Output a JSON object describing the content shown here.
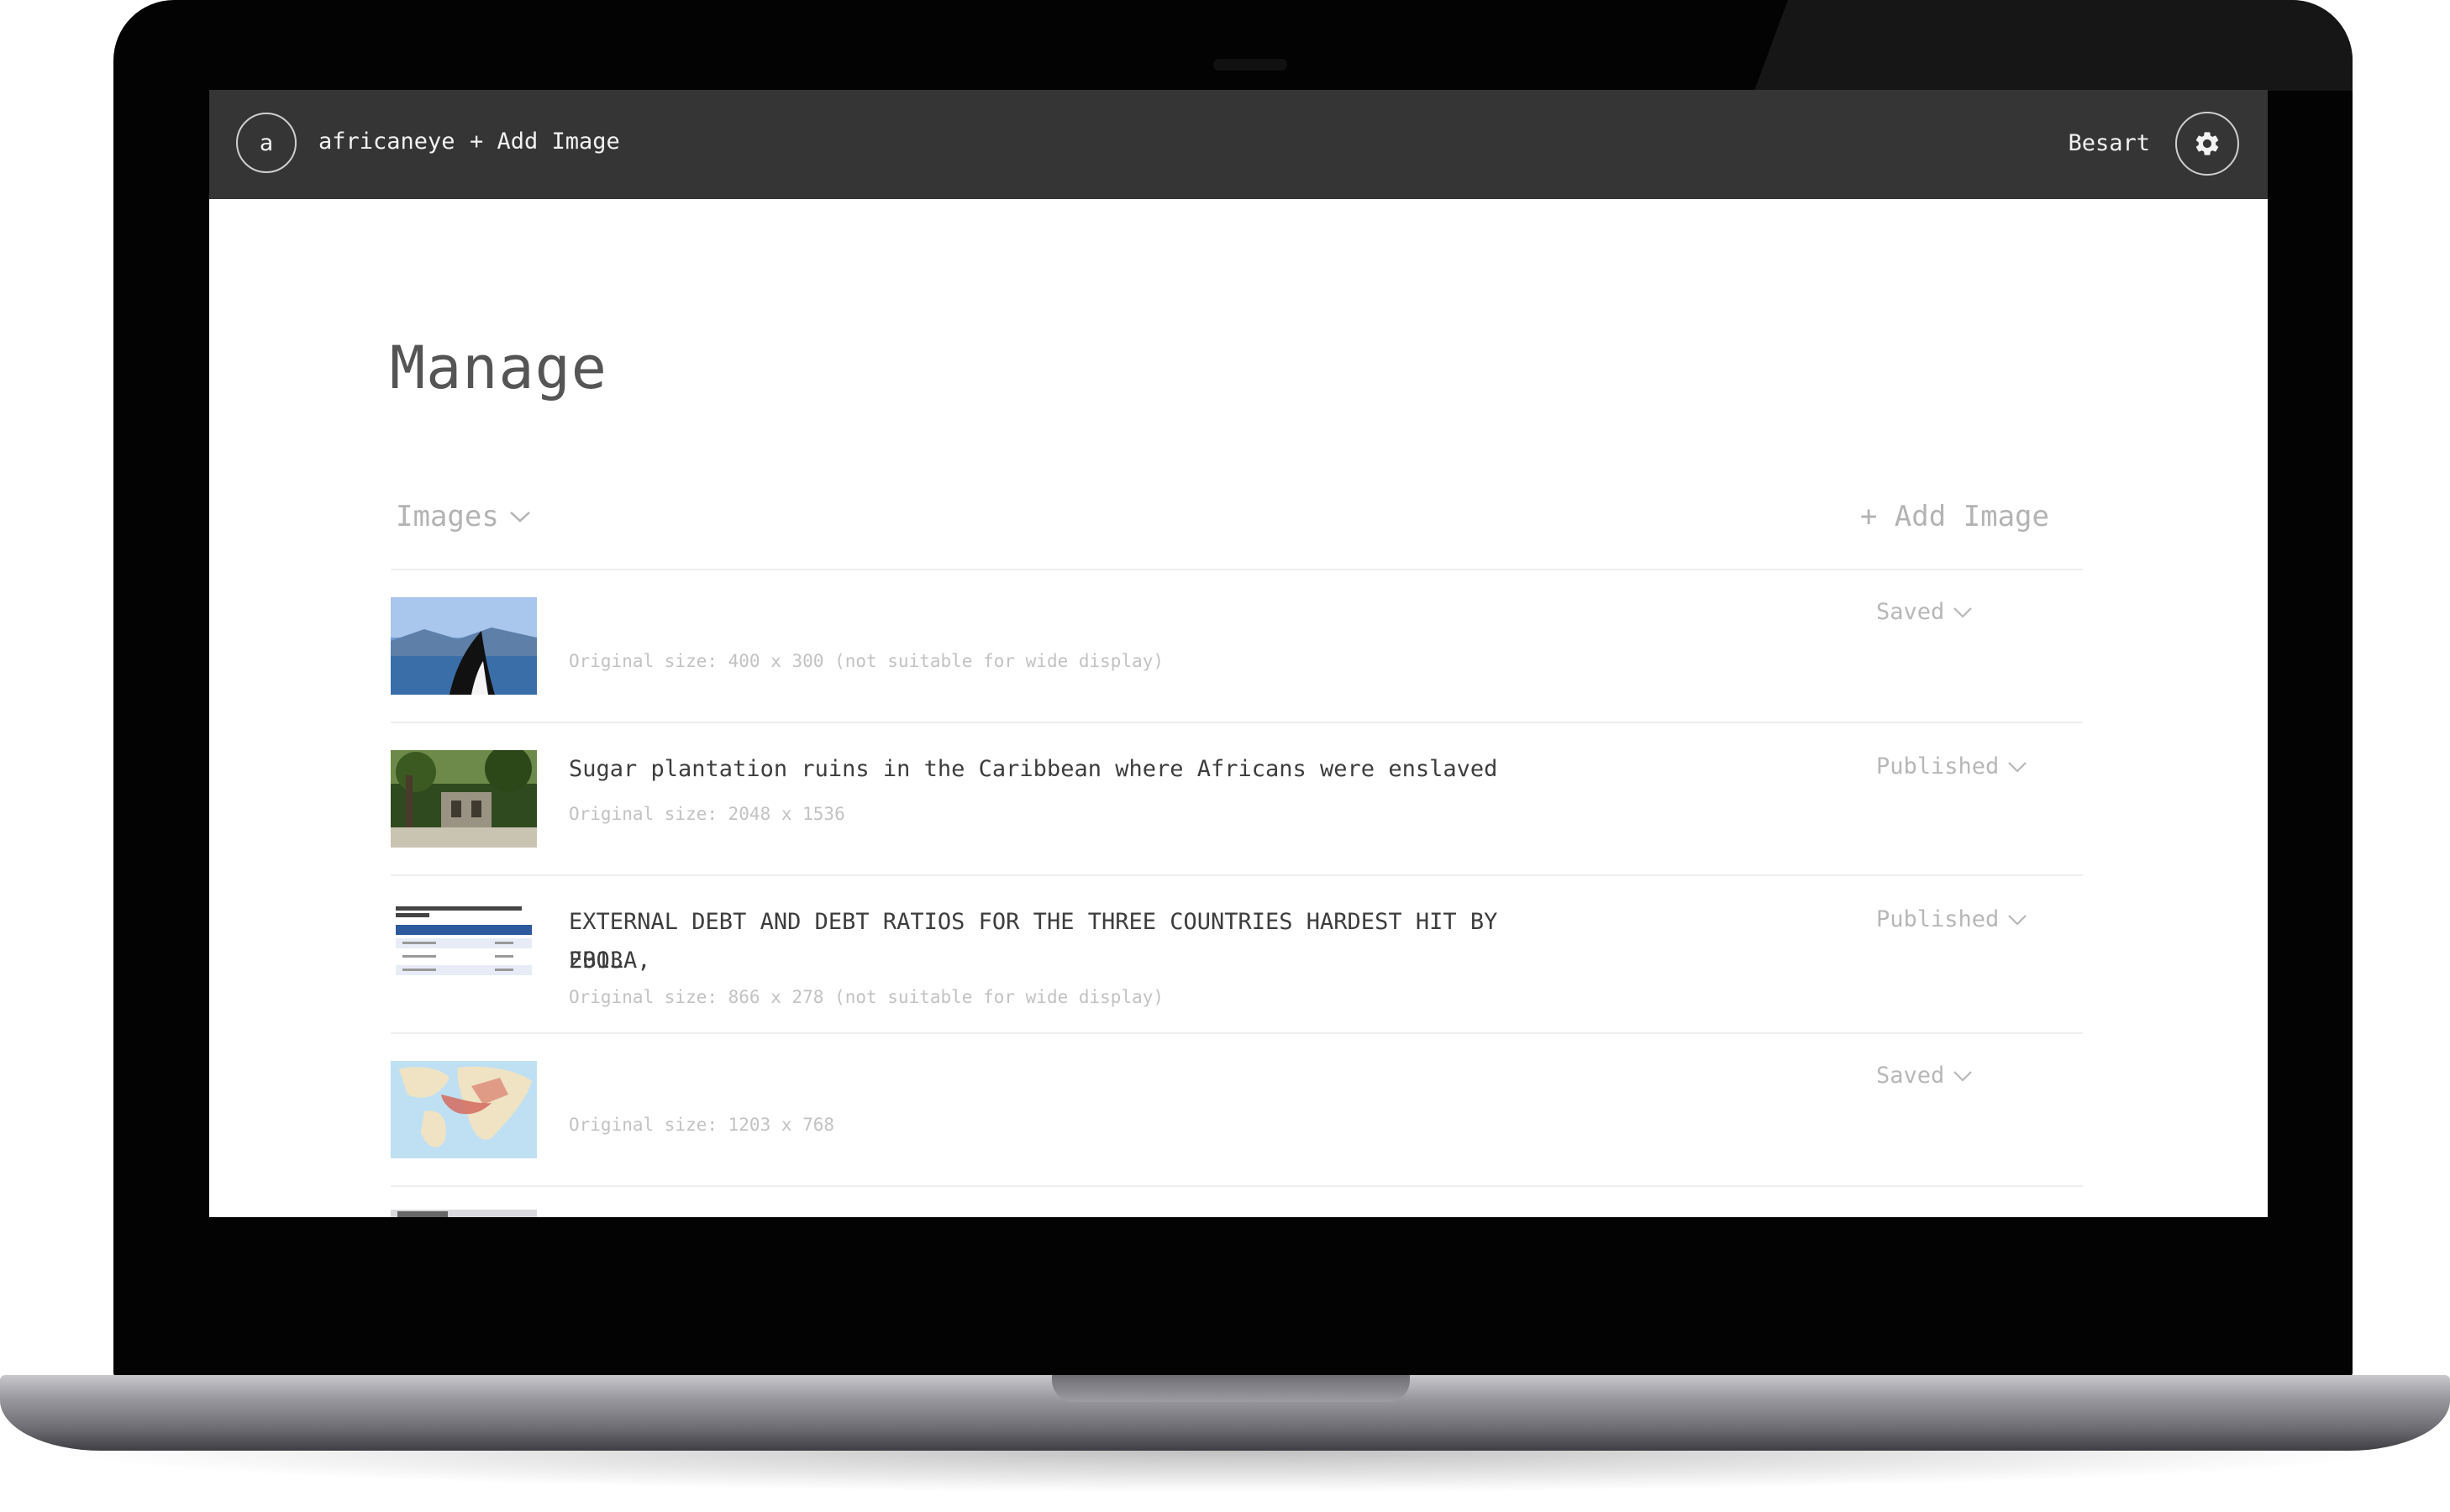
{
  "topbar": {
    "avatar_letter": "a",
    "site_name": "africaneye",
    "add_image_label": "+ Add Image",
    "user_name": "Besart"
  },
  "page": {
    "title": "Manage"
  },
  "list_header": {
    "section_label": "Images",
    "add_image_label": "+ Add Image"
  },
  "items": [
    {
      "title": "",
      "meta": "Original size: 400 x 300 (not suitable for wide display)",
      "status": "Saved",
      "thumb_desc": "orca-whale-image"
    },
    {
      "title": "Sugar plantation ruins in the Caribbean where Africans were enslaved",
      "meta": "Original size: 2048 x 1536",
      "status": "Published",
      "thumb_desc": "plantation-ruins-image"
    },
    {
      "title_line1": "EXTERNAL DEBT AND DEBT RATIOS FOR THE THREE COUNTRIES HARDEST HIT BY EBOLA,",
      "title_line2": "2013",
      "meta": "Original size: 866 x 278 (not suitable for wide display)",
      "status": "Published",
      "thumb_desc": "debt-table-image"
    },
    {
      "title": "",
      "meta": "Original size: 1203 x 768",
      "status": "Saved",
      "thumb_desc": "africa-map-image"
    }
  ]
}
